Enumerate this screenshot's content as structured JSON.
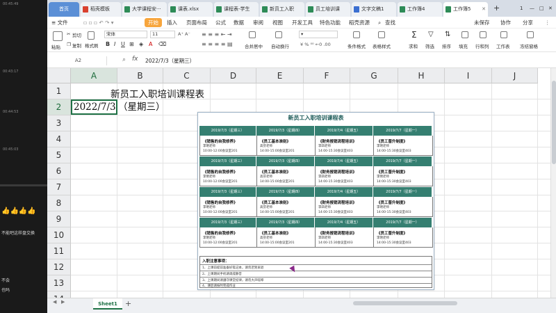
{
  "left_panel": {
    "time_marks": [
      "00:45:49",
      "00:43:17",
      "00:44:53",
      "00:45:03"
    ],
    "messages": [
      "不能吧这样盘交换",
      "不会",
      "也吗"
    ],
    "emoji": "👍👍👍👍"
  },
  "tabs": [
    {
      "label": "首页",
      "type": "home"
    },
    {
      "label": "稻壳模板",
      "color": "#d9412f"
    },
    {
      "label": "大学课程安···",
      "color": "#2e8b57"
    },
    {
      "label": "课表.xlsx",
      "color": "#2e8b57"
    },
    {
      "label": "课程表-学生",
      "color": "#2e8b57"
    },
    {
      "label": "新员工入职",
      "color": "#2e8b57"
    },
    {
      "label": "员工培训课",
      "color": "#2e8b57"
    },
    {
      "label": "文字文稿1",
      "color": "#3b6fd1"
    },
    {
      "label": "工作簿4",
      "color": "#2e8b57"
    },
    {
      "label": "工作簿5",
      "color": "#2e8b57",
      "active": true
    }
  ],
  "tab_add": "+",
  "window_controls": [
    "1",
    "—",
    "□",
    "✕"
  ],
  "menu": {
    "file": "≡ 文件",
    "items": [
      "开始",
      "插入",
      "页面布局",
      "公式",
      "数据",
      "审阅",
      "视图",
      "开发工具",
      "特色功能",
      "稻壳资源"
    ],
    "search": "查找",
    "right": [
      "未保存",
      "协作",
      "分享"
    ]
  },
  "toolbar": {
    "paste": "粘贴",
    "cut": "剪切",
    "copy": "复制",
    "format_painter": "格式刷",
    "font_name": "宋体",
    "font_size": "11",
    "merge": "合并居中",
    "wrap": "自动换行",
    "conditional": "条件格式",
    "table_style": "表格样式",
    "sum": "求和",
    "filter": "筛选",
    "sort": "排序",
    "fill": "填充",
    "rowcol": "行和列",
    "sheet": "工作表",
    "freeze": "冻结窗格"
  },
  "formula_bar": {
    "cell_ref": "A2",
    "fx": "fx",
    "content": "2022/7/3（星期三）"
  },
  "columns": [
    "A",
    "B",
    "C",
    "D",
    "E",
    "F",
    "G",
    "H",
    "I",
    "J"
  ],
  "rows": [
    "1",
    "2",
    "3",
    "4",
    "5",
    "6",
    "7",
    "8",
    "9",
    "10",
    "11",
    "12",
    "13",
    "14"
  ],
  "cells": {
    "a1": "新员工入职培训课程表",
    "a2_date": "2022/7/3",
    "a2_weekday": "（星期三）"
  },
  "schedule": {
    "title": "新员工入职培训课程表",
    "blocks": [
      {
        "header": [
          "2019/7/3（星期三）",
          "2019/7/3（星期四）",
          "2019/7/4（星期五）",
          "2019/7/7（星期一）"
        ],
        "cells": [
          [
            "《销售的自我修养》",
            "李明老师",
            "10:00-12:00会议室201"
          ],
          [
            "《员工基本准则》",
            "高芬老师",
            "14:00-15:00会议室201"
          ],
          [
            "《财务报销流程培训》",
            "李四老师",
            "14:00-15:30会议室403"
          ],
          [
            "《员工晋升制度》",
            "李明老师",
            "14:00-15:30会议室403"
          ]
        ]
      },
      {
        "header": [
          "2019/7/3（星期三）",
          "2019/7/3（星期四）",
          "2019/7/4（星期五）",
          "2019/7/7（星期一）"
        ],
        "cells": [
          [
            "《销售的自我修养》",
            "李明老师",
            "10:00-12:00会议室201"
          ],
          [
            "《员工基本准则》",
            "高芬老师",
            "14:00-15:00会议室201"
          ],
          [
            "《财务报销流程培训》",
            "李四老师",
            "14:00-15:30会议室403"
          ],
          [
            "《员工晋升制度》",
            "李明老师",
            "14:00-15:30会议室403"
          ]
        ]
      },
      {
        "header": [
          "2019/7/3（星期三）",
          "2019/7/3（星期四）",
          "2019/7/4（星期五）",
          "2019/7/7（星期一）"
        ],
        "cells": [
          [
            "《销售的自我修养》",
            "李明老师",
            "10:00-12:00会议室201"
          ],
          [
            "《员工基本准则》",
            "高芬老师",
            "14:00-15:00会议室201"
          ],
          [
            "《财务报销流程培训》",
            "李四老师",
            "14:00-15:30会议室403"
          ],
          [
            "《员工晋升制度》",
            "李明老师",
            "14:00-15:30会议室403"
          ]
        ]
      },
      {
        "header": [
          "2019/7/3（星期三）",
          "2019/7/3（星期四）",
          "2019/7/4（星期五）",
          "2019/7/7（星期一）"
        ],
        "cells": [
          [
            "《销售的自我修养》",
            "李明老师",
            "10:00-12:00会议室201"
          ],
          [
            "《员工基本准则》",
            "高芬老师",
            "14:00-15:00会议室201"
          ],
          [
            "《财务报销流程培训》",
            "李四老师",
            "14:00-15:30会议室403"
          ],
          [
            "《员工晋升制度》",
            "李明老师",
            "14:00-15:30会议室403"
          ]
        ]
      }
    ],
    "notes_title": "入职注意事项：",
    "notes": [
      "1、上课前提前准备好笔记本，请勿迟到早退",
      "2、上课期间手机请调成静音",
      "3、上课期间请遵守课堂纪律，请勿大声喧哗",
      "4、课后请按时完成作业"
    ]
  },
  "sheet_tab": "Sheet1",
  "sheet_add": "+",
  "sheet_nav": [
    "◀",
    "▶"
  ]
}
